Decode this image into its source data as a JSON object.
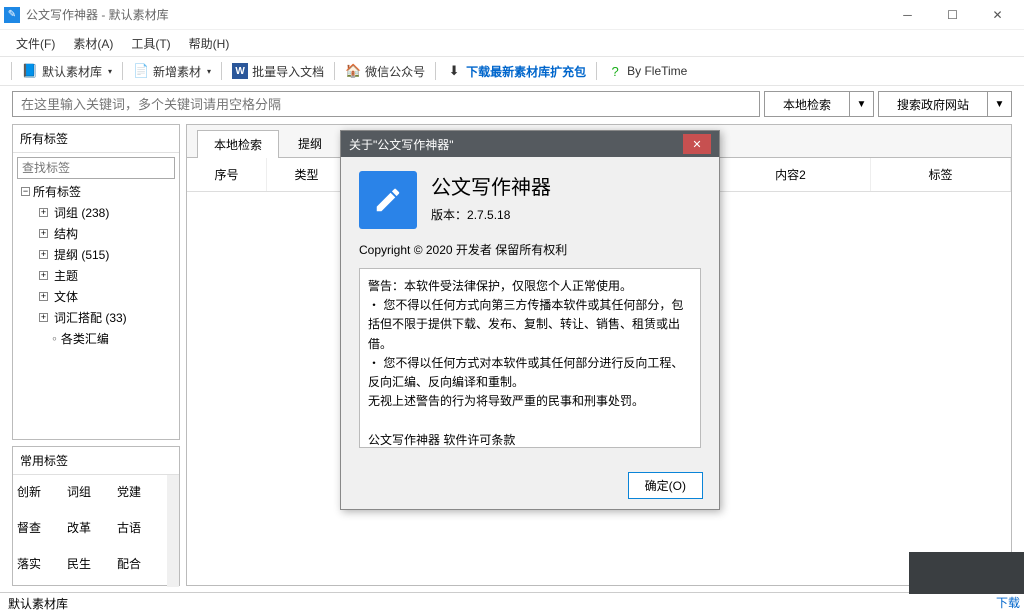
{
  "window": {
    "title": "公文写作神器  -  默认素材库"
  },
  "menubar": {
    "file": "文件(F)",
    "material": "素材(A)",
    "tool": "工具(T)",
    "help": "帮助(H)"
  },
  "toolbar": {
    "default_lib": "默认素材库",
    "new_material": "新增素材",
    "bulk_import": "批量导入文档",
    "wechat": "微信公众号",
    "download_ext": "下载最新素材库扩充包",
    "by_fletime": "By FleTime"
  },
  "search": {
    "placeholder": "在这里输入关键词，多个关键词请用空格分隔",
    "local_btn": "本地检索",
    "gov_btn": "搜索政府网站"
  },
  "sidebar": {
    "all_tags_header": "所有标签",
    "tag_search_placeholder": "查找标签",
    "root_label": "所有标签",
    "children": [
      {
        "label": "词组  (238)"
      },
      {
        "label": "结构"
      },
      {
        "label": "提纲  (515)"
      },
      {
        "label": "主题"
      },
      {
        "label": "文体"
      },
      {
        "label": "词汇搭配  (33)"
      },
      {
        "label": "各类汇编"
      }
    ],
    "common_tags_header": "常用标签",
    "common_tags": [
      "创新",
      "词组",
      "党建",
      "督查",
      "改革",
      "古语",
      "落实",
      "民生",
      "配合"
    ]
  },
  "content": {
    "tabs": {
      "local": "本地检索",
      "outline": "提纲"
    },
    "columns": {
      "c1": "序号",
      "c2": "类型",
      "c3": "",
      "c4": "内容2",
      "c5": "标签"
    }
  },
  "status": {
    "left": "默认素材库",
    "download": "下载"
  },
  "dialog": {
    "title": "关于\"公文写作神器\"",
    "app_name": "公文写作神器",
    "version_label": "版本：",
    "version": "2.7.5.18",
    "copyright": "Copyright © 2020  开发者 保留所有权利",
    "license_text": "警告：本软件受法律保护，仅限您个人正常使用。\n・ 您不得以任何方式向第三方传播本软件或其任何部分，包括但不限于提供下载、发布、复制、转让、销售、租赁或出借。\n・ 您不得以任何方式对本软件或其任何部分进行反向工程、反向汇编、反向编译和重制。\n无视上述警告的行为将导致严重的民事和刑事处罚。\n\n公文写作神器 软件许可条款\n\n本协议介绍您的权利以及您使用公文写作神器（以下简称\"本软件\"）的前提条件。接受本协议或使用本软件，即表示您同",
    "ok": "确定(O)"
  }
}
